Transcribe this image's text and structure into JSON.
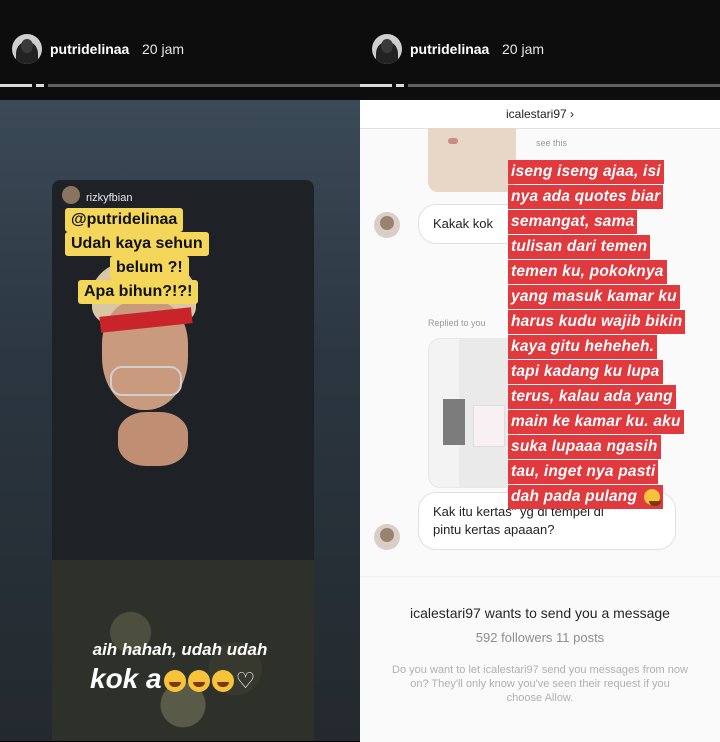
{
  "left_story": {
    "username": "putridelinaa",
    "time": "20 jam",
    "reply_user": "rizkyfbian",
    "sticker_lines": [
      "@putridelinaa",
      "Udah kaya sehun",
      "belum ?!",
      "Apa bihun?!?!"
    ],
    "caption_line1": "aih hahah, udah udah",
    "caption_line2": "kok a"
  },
  "right_story": {
    "username": "putridelinaa",
    "time": "20 jam",
    "dm_header": "icalestari97 ›",
    "small_text_1": "see this",
    "msg_1": "Kakak kok",
    "replied_to": "Replied to you",
    "msg_2_line1": "Kak itu kertas\" yg di tempel di",
    "msg_2_line2": "pintu kertas apaaan?",
    "red_lines": [
      "iseng iseng ajaa, isi",
      "nya ada quotes biar",
      "semangat, sama",
      "tulisan dari temen",
      "temen ku, pokoknya",
      "yang masuk kamar ku",
      "harus kudu wajib bikin",
      "kaya gitu heheheh.",
      "tapi kadang ku lupa",
      "terus, kalau ada yang",
      "main ke kamar ku. aku",
      "suka lupaaa ngasih",
      "tau, inget nya pasti",
      "dah pada pulang"
    ],
    "request_user": "icalestari97",
    "request_text": "wants to send you a message",
    "request_stats": "592 followers 11 posts",
    "request_body": "Do you want to let icalestari97 send you messages from now on? They'll only know you've seen their request if you choose Allow."
  }
}
